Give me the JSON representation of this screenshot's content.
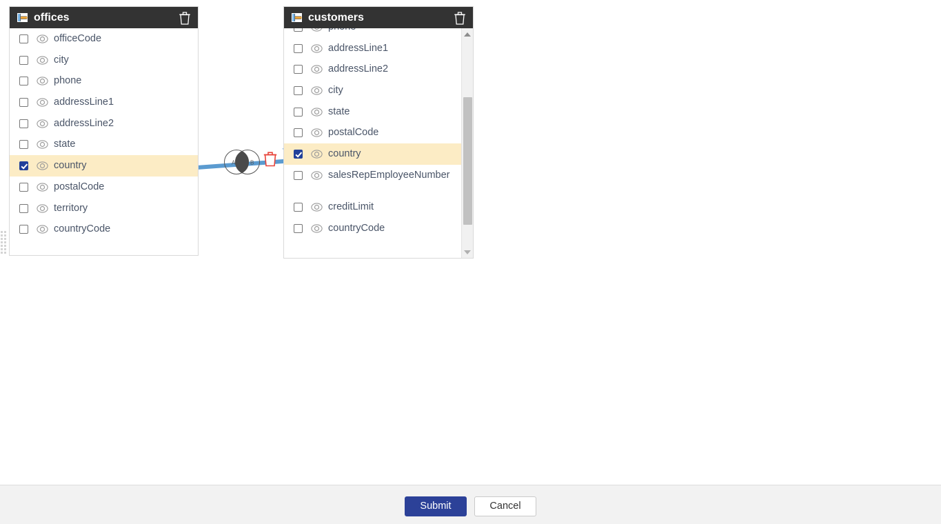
{
  "app": {
    "canvas_background": "#ffffff",
    "footer_background": "#f2f2f2",
    "accent_color": "#2c4198",
    "header_color": "#333333",
    "selected_row_color": "#fcecc5",
    "link_color": "#5b9bd0"
  },
  "tables": [
    {
      "id": "offices",
      "title": "offices",
      "table_icon": "table-icon",
      "delete_icon": "trash-icon",
      "scrolled": false,
      "fields": [
        {
          "label": "officeCode",
          "checked": false,
          "selected": false,
          "visibility_icon": "eye-icon"
        },
        {
          "label": "city",
          "checked": false,
          "selected": false,
          "visibility_icon": "eye-icon"
        },
        {
          "label": "phone",
          "checked": false,
          "selected": false,
          "visibility_icon": "eye-icon"
        },
        {
          "label": "addressLine1",
          "checked": false,
          "selected": false,
          "visibility_icon": "eye-icon"
        },
        {
          "label": "addressLine2",
          "checked": false,
          "selected": false,
          "visibility_icon": "eye-icon"
        },
        {
          "label": "state",
          "checked": false,
          "selected": false,
          "visibility_icon": "eye-icon"
        },
        {
          "label": "country",
          "checked": true,
          "selected": true,
          "visibility_icon": "eye-icon"
        },
        {
          "label": "postalCode",
          "checked": false,
          "selected": false,
          "visibility_icon": "eye-icon"
        },
        {
          "label": "territory",
          "checked": false,
          "selected": false,
          "visibility_icon": "eye-icon"
        },
        {
          "label": "countryCode",
          "checked": false,
          "selected": false,
          "visibility_icon": "eye-icon"
        }
      ]
    },
    {
      "id": "customers",
      "title": "customers",
      "table_icon": "table-icon",
      "delete_icon": "trash-icon",
      "scrolled": true,
      "fields": [
        {
          "label": "phone",
          "checked": false,
          "selected": false,
          "visibility_icon": "eye-icon",
          "clipped": true
        },
        {
          "label": "addressLine1",
          "checked": false,
          "selected": false,
          "visibility_icon": "eye-icon"
        },
        {
          "label": "addressLine2",
          "checked": false,
          "selected": false,
          "visibility_icon": "eye-icon"
        },
        {
          "label": "city",
          "checked": false,
          "selected": false,
          "visibility_icon": "eye-icon"
        },
        {
          "label": "state",
          "checked": false,
          "selected": false,
          "visibility_icon": "eye-icon"
        },
        {
          "label": "postalCode",
          "checked": false,
          "selected": false,
          "visibility_icon": "eye-icon"
        },
        {
          "label": "country",
          "checked": true,
          "selected": true,
          "visibility_icon": "eye-icon"
        },
        {
          "label": "salesRepEmployeeNumber",
          "checked": false,
          "selected": false,
          "visibility_icon": "eye-icon",
          "wraps": true
        },
        {
          "label": "creditLimit",
          "checked": false,
          "selected": false,
          "visibility_icon": "eye-icon"
        },
        {
          "label": "countryCode",
          "checked": false,
          "selected": false,
          "visibility_icon": "eye-icon"
        }
      ]
    }
  ],
  "join": {
    "type_icon": "inner-join-venn-icon",
    "left_circle_label": "A",
    "right_circle_label": "B",
    "delete_icon": "trash-icon",
    "from_table": "offices",
    "from_field": "country",
    "to_table": "customers",
    "to_field": "country"
  },
  "footer": {
    "submit_label": "Submit",
    "cancel_label": "Cancel"
  }
}
